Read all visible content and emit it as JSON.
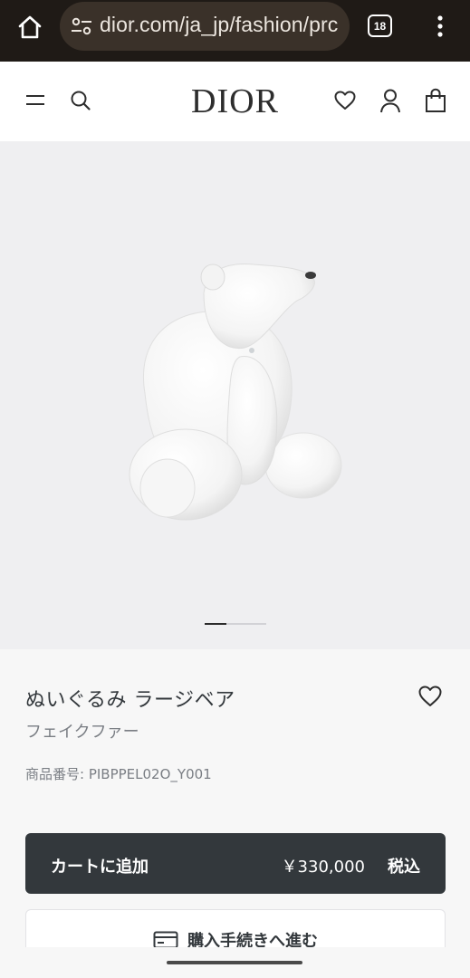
{
  "browser": {
    "url": "dior.com/ja_jp/fashion/prc",
    "tab_count": "18",
    "colors": {
      "bar": "#1f1a16",
      "url_pill": "#3a3129"
    }
  },
  "header": {
    "logo": "DIOR",
    "icons": [
      "menu-icon",
      "search-icon",
      "heart-icon",
      "account-icon",
      "bag-icon"
    ]
  },
  "gallery": {
    "image": "white plush polar bear",
    "slide_current": 1,
    "slide_total": 3
  },
  "product": {
    "name": "ぬいぐるみ ラージベア",
    "material": "フェイクファー",
    "reference": "商品番号: PIBPPEL02O_Y001"
  },
  "actions": {
    "cart_label": "カートに追加",
    "price": "￥330,000",
    "tax_label": "税込",
    "checkout_label": "購入手続きへ進む"
  },
  "colors": {
    "primary_button": "#33383c",
    "hero_bg": "#efeff1"
  }
}
